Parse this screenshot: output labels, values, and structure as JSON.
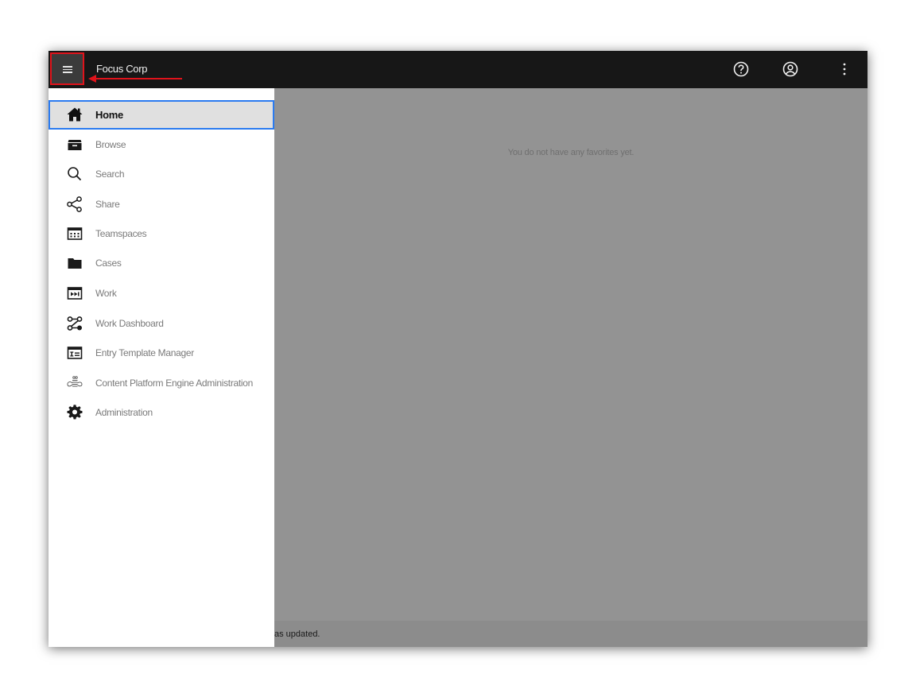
{
  "header": {
    "app_title": "Focus Corp",
    "menu_icon": "hamburger-menu-icon",
    "help_icon": "help-icon",
    "user_icon": "user-account-icon",
    "more_icon": "more-vertical-icon"
  },
  "nav": {
    "items": [
      {
        "label": "Home",
        "icon": "home-icon",
        "active": true
      },
      {
        "label": "Browse",
        "icon": "browse-icon"
      },
      {
        "label": "Search",
        "icon": "search-icon"
      },
      {
        "label": "Share",
        "icon": "share-icon"
      },
      {
        "label": "Teamspaces",
        "icon": "teamspaces-icon"
      },
      {
        "label": "Cases",
        "icon": "folder-icon"
      },
      {
        "label": "Work",
        "icon": "work-icon"
      },
      {
        "label": "Work Dashboard",
        "icon": "workflow-icon"
      },
      {
        "label": "Entry Template Manager",
        "icon": "entry-template-icon"
      },
      {
        "label": "Content Platform Engine Administration",
        "icon": "cpe-admin-icon"
      },
      {
        "label": "Administration",
        "icon": "gear-icon"
      }
    ]
  },
  "main": {
    "empty_message": "You do not have any favorites yet."
  },
  "status": {
    "text": "as updated."
  },
  "colors": {
    "topbar": "#171717",
    "overlay": "#939393",
    "active_border": "#2b7bf0",
    "annotation_red": "#e0131b"
  }
}
